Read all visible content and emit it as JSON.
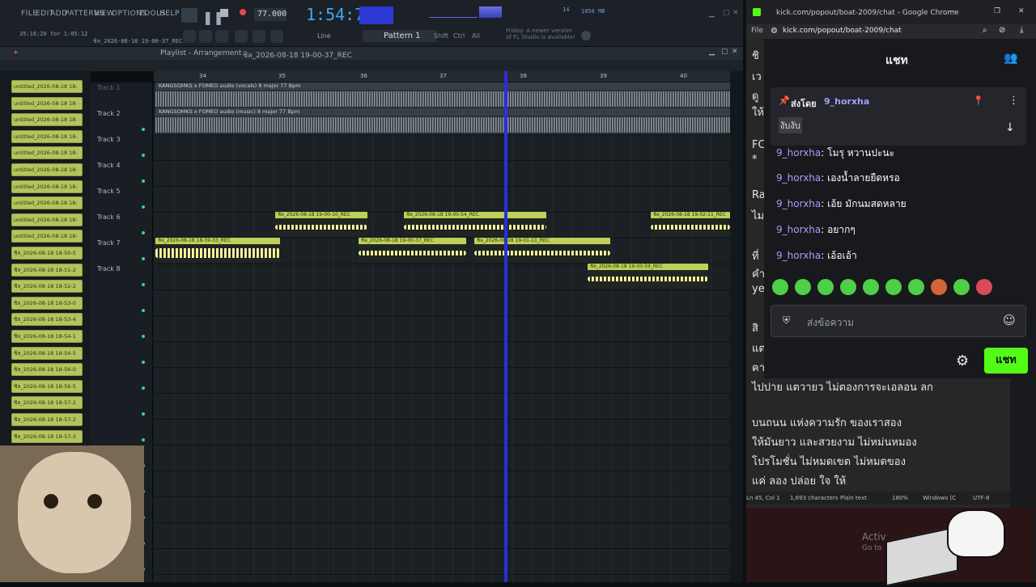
{
  "fl": {
    "menu": [
      "FILE",
      "EDIT",
      "ADD",
      "PATTERNS",
      "VIEW",
      "OPTIONS",
      "TOOLS",
      "HELP"
    ],
    "tempo": "77.000",
    "time": "1:54:78",
    "pattern": "Pattern 1",
    "info_line1": "35:16:20 for 1:05:12",
    "info_line2": "ชิล_2026-08-18 19-00-37_REC",
    "hint_text": "Friday: A newer version of FL Studio is available!",
    "line_label": "Line",
    "snap_labels": [
      "Shift",
      "Ctrl",
      "All"
    ],
    "memory": "1050 MB",
    "cpu_count": "14"
  },
  "playlist": {
    "title": "Playlist - Arrangement",
    "breadcrumb": "ชิล_2026-08-18 19-00-37_REC",
    "ticks": [
      "34",
      "35",
      "36",
      "37",
      "38",
      "39",
      "40"
    ],
    "tracks": [
      "Track 1",
      "Track 2",
      "Track 3",
      "Track 4",
      "Track 5",
      "Track 6",
      "Track 7",
      "Track 8"
    ],
    "audio1": "KANGSOMKS x FOMEO audio (vocals) 8 major 77 Bpm",
    "audio2": "KANGSOMKS x FOMEO audio (music) 8 major 77 Bpm",
    "clips": {
      "t6a": "ชิล_2026-08-18 19-00-10_REC",
      "t6b": "ชิล_2026-08-18 19-00-54_REC",
      "t6c": "ชิล_2026-08-18 19-02-11_REC",
      "t7a": "ชิล_2026-08-18 18-59-33_REC",
      "t7b": "ชิล_2026-08-18 19-00-37_REC",
      "t7c": "ชิล_2026-08-18 19-01-11_REC",
      "t8a": "ชิล_2026-08-18 19-03-59_REC"
    },
    "browser": [
      "untitled_2026-08-18 18-",
      "untitled_2026-08-18 18-",
      "untitled_2026-08-18 18-",
      "untitled_2026-08-18 18-",
      "untitled_2026-08-18 18-",
      "untitled_2026-08-18 18-",
      "untitled_2026-08-18 18-",
      "untitled_2026-08-18 18-",
      "untitled_2026-08-18 18-",
      "untitled_2026-08-18 18-",
      "ชิล_2026-08-18 18-50-5",
      "ชิล_2026-08-18 18-51-2",
      "ชิล_2026-08-18 18-52-2",
      "ชิล_2026-08-18 18-53-0",
      "ชิล_2026-08-18 18-53-4",
      "ชิล_2026-08-18 18-54-1",
      "ชิล_2026-08-18 18-54-5",
      "ชิล_2026-08-18 18-56-0",
      "ชิล_2026-08-18 18-56-5",
      "ชิล_2026-08-18 18-57-2",
      "ชิล_2026-08-18 18-57-2",
      "ชิล_2026-08-18 18-57-3"
    ]
  },
  "chrome": {
    "window_title": "kick.com/popout/boat-2009/chat - Google Chrome",
    "url": "kick.com/popout/boat-2009/chat",
    "chat_title": "แชท",
    "pinned_label": "ส่งโดย",
    "pinned_user": "9_horxha",
    "pinned_text": "งับงับ",
    "messages": [
      {
        "user": "9_horxha",
        "text": ": โมรุ หวานปะนะ"
      },
      {
        "user": "9_horxha",
        "text": ": เองน้ำลายยืดหรอ"
      },
      {
        "user": "9_horxha",
        "text": ": เอ้ย มักนมสดหลาย"
      },
      {
        "user": "9_horxha",
        "text": ": อยากๆ"
      },
      {
        "user": "9_horxha",
        "text": ": เอ้อเอ้า"
      }
    ],
    "input_placeholder": "ส่งข้อความ",
    "send_label": "แชท"
  },
  "notepad": {
    "left_fragments": [
      "ชิ",
      "เว",
      "ดู",
      "ให้",
      "FC",
      "*",
      "Ra",
      "ไม",
      "ที่",
      "คำ",
      "ye",
      "สิ",
      "แต",
      "คา"
    ],
    "lines": [
      "ไปปาย  แตวายว  ไม่ตองการจะเอลอน  ลก",
      "บนถนน  แห่งความรัก  ของเราสอง",
      "ให้มันยาว  และสวยงาม  ไม่หม่นหมอง",
      "โปรโมชั่น  ไม่หมดเขต  ไม่หมดของ",
      "แค่  ลอง  ปล่อย  ใจ  ให้"
    ],
    "status": [
      "Ln 45, Col 1",
      "1,693 characters",
      "Plain text",
      "180%",
      "Windows (C",
      "UTF-8"
    ]
  },
  "overlay": {
    "activate": "Activ",
    "goto": "Go to"
  },
  "colors": {
    "accent_green": "#53fc18",
    "playhead": "#2a2fd8",
    "clip": "#bfd058"
  }
}
